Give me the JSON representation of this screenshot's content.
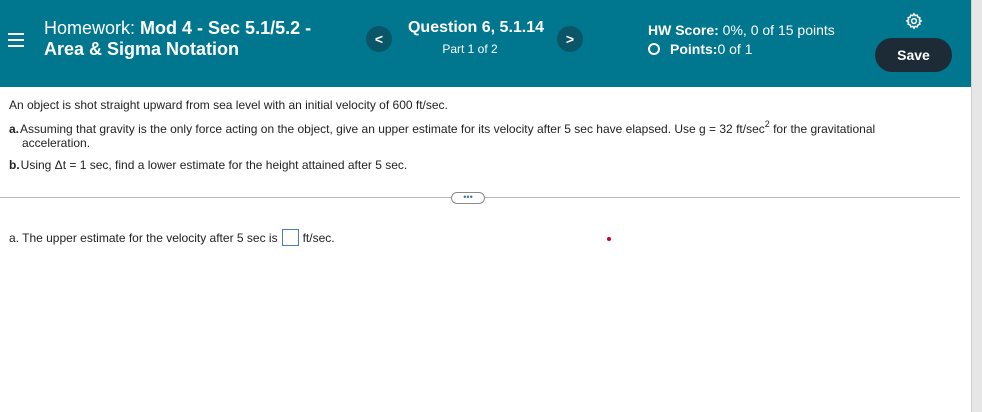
{
  "header": {
    "homework_lead": "Homework: ",
    "homework_title": "Mod 4 - Sec 5.1/5.2 - Area & Sigma Notation",
    "prev_label": "<",
    "next_label": ">",
    "question_title": "Question 6, 5.1.14",
    "question_part": "Part 1 of 2",
    "hw_score_label": "HW Score:",
    "hw_score_value": " 0%, 0 of 15 points",
    "points_label": "Points:",
    "points_value": " 0 of 1",
    "save_label": "Save"
  },
  "problem": {
    "intro": "An object is shot straight upward from sea level with an initial velocity of 600 ft/sec.",
    "part_a_label": "a.",
    "part_a_text_before_sup": "Assuming that gravity is the only force acting on the object, give an upper estimate for its velocity after 5 sec have elapsed. Use g = 32 ft/sec",
    "part_a_sup": "2",
    "part_a_text_after_sup": " for the gravitational",
    "part_a_continuation": "acceleration.",
    "part_b_label": "b.",
    "part_b_text": "Using Δt = 1 sec, find a lower estimate for the height attained after 5 sec."
  },
  "divider": {
    "more_label": "•••"
  },
  "answer": {
    "prefix": "a. The upper estimate for the velocity after 5 sec is",
    "unit": "ft/sec.",
    "value": ""
  },
  "icons": {
    "menu": "menu-icon",
    "gear": "gear-icon"
  },
  "colors": {
    "header_bg": "#00768f",
    "nav_btn_bg": "#0b5568",
    "save_btn_bg": "#1d2b36",
    "input_border": "#4a7db8"
  }
}
